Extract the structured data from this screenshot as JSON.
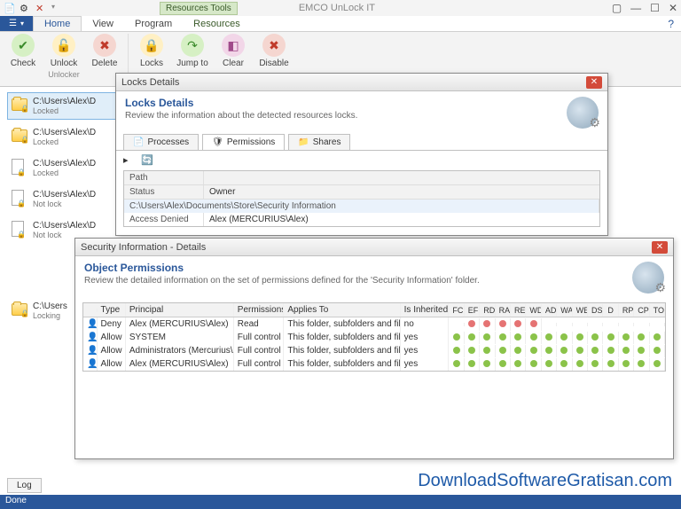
{
  "app": {
    "title": "EMCO UnLock IT",
    "contextual_tab": "Resources Tools"
  },
  "tabs": {
    "file": "☰",
    "home": "Home",
    "view": "View",
    "program": "Program",
    "resources": "Resources"
  },
  "ribbon": {
    "group1": {
      "check": "Check",
      "unlock": "Unlock",
      "delete": "Delete",
      "label": "Unlocker"
    },
    "group2": {
      "locks": "Locks",
      "jump": "Jump to",
      "clear": "Clear",
      "disable": "Disable"
    }
  },
  "sidebar": {
    "items": [
      {
        "path": "C:\\Users\\Alex\\D",
        "status": "Locked",
        "icon": "folder-lock",
        "selected": true
      },
      {
        "path": "C:\\Users\\Alex\\D",
        "status": "Locked",
        "icon": "folder-lock"
      },
      {
        "path": "C:\\Users\\Alex\\D",
        "status": "Locked",
        "icon": "file-lock"
      },
      {
        "path": "C:\\Users\\Alex\\D",
        "status": "Not lock",
        "icon": "file-lock"
      },
      {
        "path": "C:\\Users\\Alex\\D",
        "status": "Not lock",
        "icon": "file-lock"
      },
      {
        "path": "C:\\Users",
        "status": "Locking",
        "icon": "folder-lock"
      }
    ]
  },
  "locks_dialog": {
    "title": "Locks Details",
    "heading": "Locks Details",
    "subheading": "Review the information about the detected resources locks.",
    "tabs": {
      "processes": "Processes",
      "permissions": "Permissions",
      "shares": "Shares"
    },
    "grid": {
      "headers": {
        "path": "Path",
        "status": "Status",
        "owner": "Owner"
      },
      "path_value": "C:\\Users\\Alex\\Documents\\Store\\Security Information",
      "status_value": "Access Denied",
      "owner_value": "Alex (MERCURIUS\\Alex)"
    }
  },
  "security_dialog": {
    "title": "Security Information - Details",
    "heading": "Object Permissions",
    "subheading": "Review the detailed information on the set of permissions defined for the 'Security Information' folder.",
    "columns": {
      "type": "Type",
      "principal": "Principal",
      "permissions": "Permissions",
      "applies": "Applies To",
      "inherited": "Is Inherited",
      "flags": [
        "FC",
        "EF",
        "RD",
        "RA",
        "RE",
        "WD",
        "AD",
        "WA",
        "WE",
        "DS",
        "D",
        "RP",
        "CP",
        "TO"
      ]
    },
    "rows": [
      {
        "type": "Deny",
        "principal": "Alex (MERCURIUS\\Alex)",
        "perm": "Read",
        "applies": "This folder, subfolders and files",
        "inh": "no",
        "flags": [
          "",
          "r",
          "r",
          "r",
          "r",
          "r",
          "",
          "",
          "",
          "",
          "",
          "",
          "",
          ""
        ]
      },
      {
        "type": "Allow",
        "principal": "SYSTEM",
        "perm": "Full control",
        "applies": "This folder, subfolders and files",
        "inh": "yes",
        "flags": [
          "g",
          "g",
          "g",
          "g",
          "g",
          "g",
          "g",
          "g",
          "g",
          "g",
          "g",
          "g",
          "g",
          "g"
        ]
      },
      {
        "type": "Allow",
        "principal": "Administrators (Mercurius\\Ad...",
        "perm": "Full control",
        "applies": "This folder, subfolders and files",
        "inh": "yes",
        "flags": [
          "g",
          "g",
          "g",
          "g",
          "g",
          "g",
          "g",
          "g",
          "g",
          "g",
          "g",
          "g",
          "g",
          "g"
        ]
      },
      {
        "type": "Allow",
        "principal": "Alex (MERCURIUS\\Alex)",
        "perm": "Full control",
        "applies": "This folder, subfolders and files",
        "inh": "yes",
        "flags": [
          "g",
          "g",
          "g",
          "g",
          "g",
          "g",
          "g",
          "g",
          "g",
          "g",
          "g",
          "g",
          "g",
          "g"
        ]
      }
    ]
  },
  "bottom": {
    "log": "Log",
    "status": "Done",
    "watermark": "DownloadSoftwareGratisan.com"
  }
}
